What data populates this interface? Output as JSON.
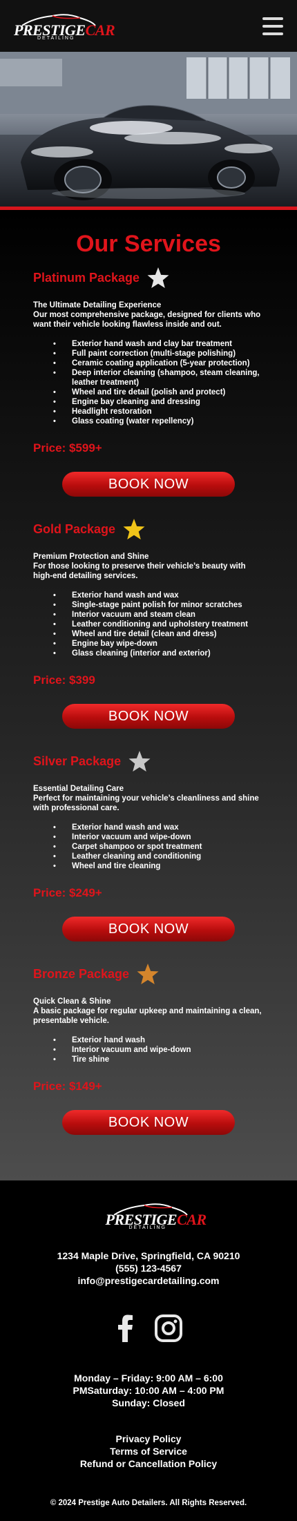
{
  "header": {
    "brand_white": "PRESTIGE",
    "brand_red": "CAR",
    "tagline": "DETAILING"
  },
  "services": {
    "title": "Our Services",
    "packages": [
      {
        "name": "Platinum Package",
        "star_color": "#e6e6e6",
        "subtitle": "The Ultimate Detailing Experience",
        "description": "Our most comprehensive package, designed for clients who want their vehicle looking flawless inside and out.",
        "features": [
          "Exterior hand wash and clay bar treatment",
          "Full paint correction (multi-stage polishing)",
          "Ceramic coating application (5-year protection)",
          "Deep interior cleaning (shampoo, steam cleaning, leather treatment)",
          "Wheel and tire detail (polish and protect)",
          "Engine bay cleaning and dressing",
          "Headlight restoration",
          "Glass coating (water repellency)"
        ],
        "price": "Price: $599+",
        "button": "BOOK NOW"
      },
      {
        "name": "Gold Package",
        "star_color": "#f0c419",
        "subtitle": "Premium Protection and Shine",
        "description": "For those looking to preserve their vehicle’s beauty with high-end detailing services.",
        "features": [
          "Exterior hand wash and wax",
          "Single-stage paint polish for minor scratches",
          "Interior vacuum and steam clean",
          "Leather conditioning and upholstery treatment",
          "Wheel and tire detail (clean and dress)",
          "Engine bay wipe-down",
          "Glass cleaning (interior and exterior)"
        ],
        "price": "Price: $399",
        "button": "BOOK NOW"
      },
      {
        "name": "Silver Package",
        "star_color": "#c8c8c8",
        "subtitle": "Essential Detailing Care",
        "description": "Perfect for maintaining your vehicle’s cleanliness and shine with professional care.",
        "features": [
          "Exterior hand wash and wax",
          "Interior vacuum and wipe-down",
          "Carpet shampoo or spot treatment",
          "Leather cleaning and conditioning",
          "Wheel and tire cleaning"
        ],
        "price": "Price: $249+",
        "button": "BOOK NOW"
      },
      {
        "name": "Bronze Package",
        "star_color": "#d4852c",
        "subtitle": "Quick Clean & Shine",
        "description": "A basic package for regular upkeep and maintaining a clean, presentable vehicle.",
        "features": [
          "Exterior hand wash",
          "Interior vacuum and wipe-down",
          "Tire shine"
        ],
        "price": "Price: $149+",
        "button": "BOOK NOW"
      }
    ]
  },
  "footer": {
    "brand_white": "PRESTIGE",
    "brand_red": "CAR",
    "tagline": "DETAILING",
    "address": "1234 Maple Drive, Springfield, CA 90210",
    "phone": "(555) 123-4567",
    "email": "info@prestigecardetailing.com",
    "hours_line1": "Monday – Friday: 9:00 AM – 6:00",
    "hours_line2": "PMSaturday: 10:00 AM – 4:00 PM",
    "hours_line3": "Sunday: Closed",
    "links": [
      "Privacy Policy",
      "Terms of Service",
      "Refund or Cancellation Policy"
    ],
    "copyright": "© 2024 Prestige Auto Detailers. All Rights Reserved."
  },
  "colors": {
    "accent": "#e0141b",
    "background": "#000000"
  },
  "icons": {
    "menu": "hamburger-menu-icon",
    "facebook": "facebook-icon",
    "instagram": "instagram-icon",
    "star": "star-icon"
  }
}
